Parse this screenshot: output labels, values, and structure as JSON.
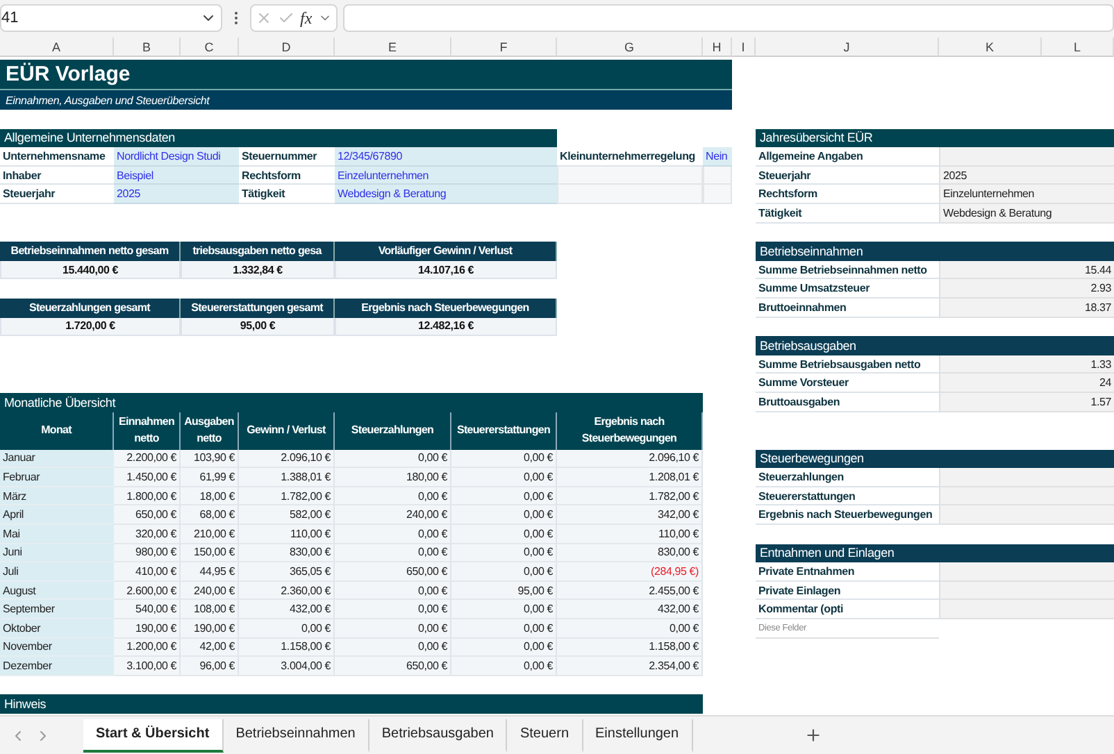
{
  "formula_bar": {
    "name_box": "41",
    "function_label": "fx"
  },
  "column_headers": [
    "A",
    "B",
    "C",
    "D",
    "E",
    "F",
    "G",
    "H",
    "I",
    "J",
    "K",
    "L"
  ],
  "title": "EÜR Vorlage",
  "subtitle": "Einnahmen, Ausgaben und Steuerübersicht",
  "company": {
    "title": "Allgemeine Unternehmensdaten",
    "fields": [
      {
        "label": "Unternehmensname",
        "value": "Nordlicht Design Studi"
      },
      {
        "label": "Steuernummer",
        "value": "12/345/67890"
      },
      {
        "label": "Inhaber",
        "value": "Beispiel"
      },
      {
        "label": "Rechtsform",
        "value": "Einzelunternehmen"
      },
      {
        "label": "Steuerjahr",
        "value": "2025"
      },
      {
        "label": "Tätigkeit",
        "value": "Webdesign & Beratung"
      }
    ],
    "small_business": {
      "label": "Kleinunternehmerregelung",
      "value": "Nein"
    }
  },
  "kpis": [
    {
      "label": "Betriebseinnahmen netto gesam",
      "value": "15.440,00 €"
    },
    {
      "label": "triebsausgaben netto gesa",
      "value": "1.332,84 €"
    },
    {
      "label": "Vorläufiger Gewinn / Verlust",
      "value": "14.107,16 €"
    },
    {
      "label": "Steuerzahlungen gesamt",
      "value": "1.720,00 €"
    },
    {
      "label": "Steuererstattungen gesamt",
      "value": "95,00 €"
    },
    {
      "label": "Ergebnis nach Steuerbewegungen",
      "value": "12.482,16 €"
    }
  ],
  "monthly": {
    "title": "Monatliche Übersicht",
    "columns": [
      "Monat",
      "Einnahmen netto",
      "Ausgaben netto",
      "Gewinn / Verlust",
      "Steuerzahlungen",
      "Steuererstattungen",
      "Ergebnis nach Steuerbewegungen"
    ],
    "rows": [
      {
        "cells": [
          "Januar",
          "2.200,00 €",
          "103,90 €",
          "2.096,10 €",
          "0,00 €",
          "0,00 €",
          "2.096,10 €"
        ],
        "negative": false
      },
      {
        "cells": [
          "Februar",
          "1.450,00 €",
          "61,99 €",
          "1.388,01 €",
          "180,00 €",
          "0,00 €",
          "1.208,01 €"
        ],
        "negative": false
      },
      {
        "cells": [
          "März",
          "1.800,00 €",
          "18,00 €",
          "1.782,00 €",
          "0,00 €",
          "0,00 €",
          "1.782,00 €"
        ],
        "negative": false
      },
      {
        "cells": [
          "April",
          "650,00 €",
          "68,00 €",
          "582,00 €",
          "240,00 €",
          "0,00 €",
          "342,00 €"
        ],
        "negative": false
      },
      {
        "cells": [
          "Mai",
          "320,00 €",
          "210,00 €",
          "110,00 €",
          "0,00 €",
          "0,00 €",
          "110,00 €"
        ],
        "negative": false
      },
      {
        "cells": [
          "Juni",
          "980,00 €",
          "150,00 €",
          "830,00 €",
          "0,00 €",
          "0,00 €",
          "830,00 €"
        ],
        "negative": false
      },
      {
        "cells": [
          "Juli",
          "410,00 €",
          "44,95 €",
          "365,05 €",
          "650,00 €",
          "0,00 €",
          "(284,95 €)"
        ],
        "negative": true
      },
      {
        "cells": [
          "August",
          "2.600,00 €",
          "240,00 €",
          "2.360,00 €",
          "0,00 €",
          "95,00 €",
          "2.455,00 €"
        ],
        "negative": false
      },
      {
        "cells": [
          "September",
          "540,00 €",
          "108,00 €",
          "432,00 €",
          "0,00 €",
          "0,00 €",
          "432,00 €"
        ],
        "negative": false
      },
      {
        "cells": [
          "Oktober",
          "190,00 €",
          "190,00 €",
          "0,00 €",
          "0,00 €",
          "0,00 €",
          "0,00 €"
        ],
        "negative": false
      },
      {
        "cells": [
          "November",
          "1.200,00 €",
          "42,00 €",
          "1.158,00 €",
          "0,00 €",
          "0,00 €",
          "1.158,00 €"
        ],
        "negative": false
      },
      {
        "cells": [
          "Dezember",
          "3.100,00 €",
          "96,00 €",
          "3.004,00 €",
          "650,00 €",
          "0,00 €",
          "2.354,00 €"
        ],
        "negative": false
      }
    ]
  },
  "note": {
    "title": "Hinweis"
  },
  "annual": [
    {
      "title": "Jahresübersicht EÜR",
      "kind": "info",
      "rows": [
        {
          "label": "Allgemeine Angaben"
        },
        {
          "label": "Steuerjahr",
          "value": "2025"
        },
        {
          "label": "Rechtsform",
          "value": "Einzelunternehmen"
        },
        {
          "label": "Tätigkeit",
          "value": "Webdesign & Beratung"
        }
      ]
    },
    {
      "title": "Betriebseinnahmen",
      "kind": "amounts",
      "rows": [
        {
          "label": "Summe Betriebseinnahmen netto",
          "value": "15.44"
        },
        {
          "label": "Summe Umsatzsteuer",
          "value": "2.93"
        },
        {
          "label": "Bruttoeinnahmen",
          "value": "18.37"
        }
      ]
    },
    {
      "title": "Betriebsausgaben",
      "kind": "amounts",
      "rows": [
        {
          "label": "Summe Betriebsausgaben netto",
          "value": "1.33"
        },
        {
          "label": "Summe Vorsteuer",
          "value": "24"
        },
        {
          "label": "Bruttoausgaben",
          "value": "1.57"
        }
      ]
    },
    {
      "title": "Steuerbewegungen",
      "kind": "amounts",
      "rows": [
        {
          "label": "Steuerzahlungen"
        },
        {
          "label": "Steuererstattungen"
        },
        {
          "label": "Ergebnis nach Steuerbewegungen"
        }
      ]
    },
    {
      "title": "Entnahmen und Einlagen",
      "kind": "amounts",
      "rows": [
        {
          "label": "Private Entnahmen"
        },
        {
          "label": "Private Einlagen"
        },
        {
          "label": "Kommentar (opti"
        }
      ],
      "note": "Diese Felder"
    }
  ],
  "sheet_tabs": [
    {
      "label": "Start & Übersicht",
      "selected": true
    },
    {
      "label": "Betriebseinnahmen",
      "selected": false
    },
    {
      "label": "Betriebsausgaben",
      "selected": false
    },
    {
      "label": "Steuern",
      "selected": false
    },
    {
      "label": "Einstellungen",
      "selected": false
    }
  ]
}
